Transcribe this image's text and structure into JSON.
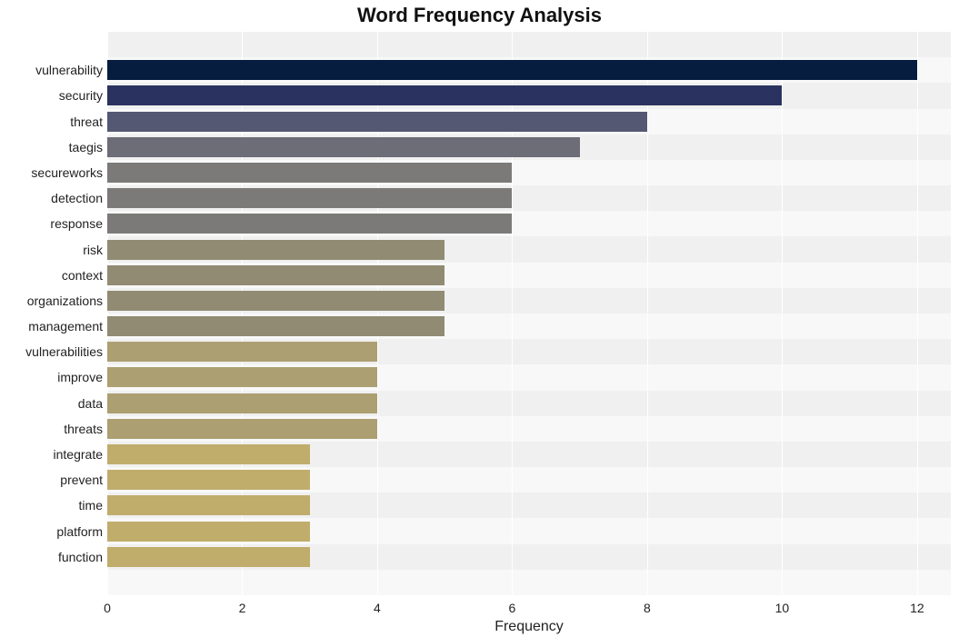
{
  "chart_data": {
    "type": "bar",
    "orientation": "horizontal",
    "title": "Word Frequency Analysis",
    "xlabel": "Frequency",
    "ylabel": "",
    "xlim": [
      0,
      12.5
    ],
    "xticks": [
      0,
      2,
      4,
      6,
      8,
      10,
      12
    ],
    "categories": [
      "vulnerability",
      "security",
      "threat",
      "taegis",
      "secureworks",
      "detection",
      "response",
      "risk",
      "context",
      "organizations",
      "management",
      "vulnerabilities",
      "improve",
      "data",
      "threats",
      "integrate",
      "prevent",
      "time",
      "platform",
      "function"
    ],
    "values": [
      12,
      10,
      8,
      7,
      6,
      6,
      6,
      5,
      5,
      5,
      5,
      4,
      4,
      4,
      4,
      3,
      3,
      3,
      3,
      3
    ],
    "colors": [
      "#071d3f",
      "#2a335f",
      "#555872",
      "#6d6d78",
      "#7b7a78",
      "#7b7a78",
      "#7b7a78",
      "#918b73",
      "#918b73",
      "#918b73",
      "#918b73",
      "#ac9f72",
      "#ac9f72",
      "#ac9f72",
      "#ac9f72",
      "#c0ad6c",
      "#c0ad6c",
      "#c0ad6c",
      "#c0ad6c",
      "#c0ad6c"
    ]
  }
}
